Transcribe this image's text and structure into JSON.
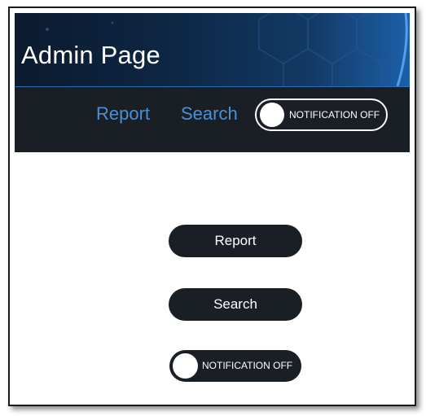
{
  "header": {
    "title": "Admin Page"
  },
  "nav": {
    "links": [
      {
        "label": "Report"
      },
      {
        "label": "Search"
      }
    ],
    "notification_toggle": {
      "label": "NOTIFICATION OFF",
      "state": "off"
    }
  },
  "main": {
    "report_button": "Report",
    "search_button": "Search",
    "notification_toggle": {
      "label": "NOTIFICATION OFF",
      "state": "off"
    }
  },
  "colors": {
    "nav_background": "#1a1f25",
    "link_color": "#4a90d9",
    "hero_accent": "#1d5fa8"
  }
}
